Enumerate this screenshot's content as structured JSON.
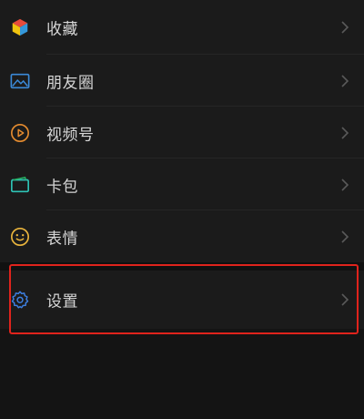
{
  "menu": {
    "items": [
      {
        "label": "收藏",
        "icon": "cube-icon"
      },
      {
        "label": "朋友圈",
        "icon": "image-icon"
      },
      {
        "label": "视频号",
        "icon": "play-circle-icon"
      },
      {
        "label": "卡包",
        "icon": "card-wallet-icon"
      },
      {
        "label": "表情",
        "icon": "smiley-icon"
      }
    ],
    "settings": {
      "label": "设置",
      "icon": "gear-icon"
    }
  },
  "colors": {
    "background": "#161616",
    "row_background": "#1b1b1b",
    "text": "#d6d6d6",
    "chevron": "#5a5a5a",
    "highlight": "#e0231c",
    "gear_blue": "#3d7fe0",
    "play_orange": "#e48b2f",
    "smiley_yellow": "#e9b43c",
    "image_blue": "#3b8ad8"
  }
}
